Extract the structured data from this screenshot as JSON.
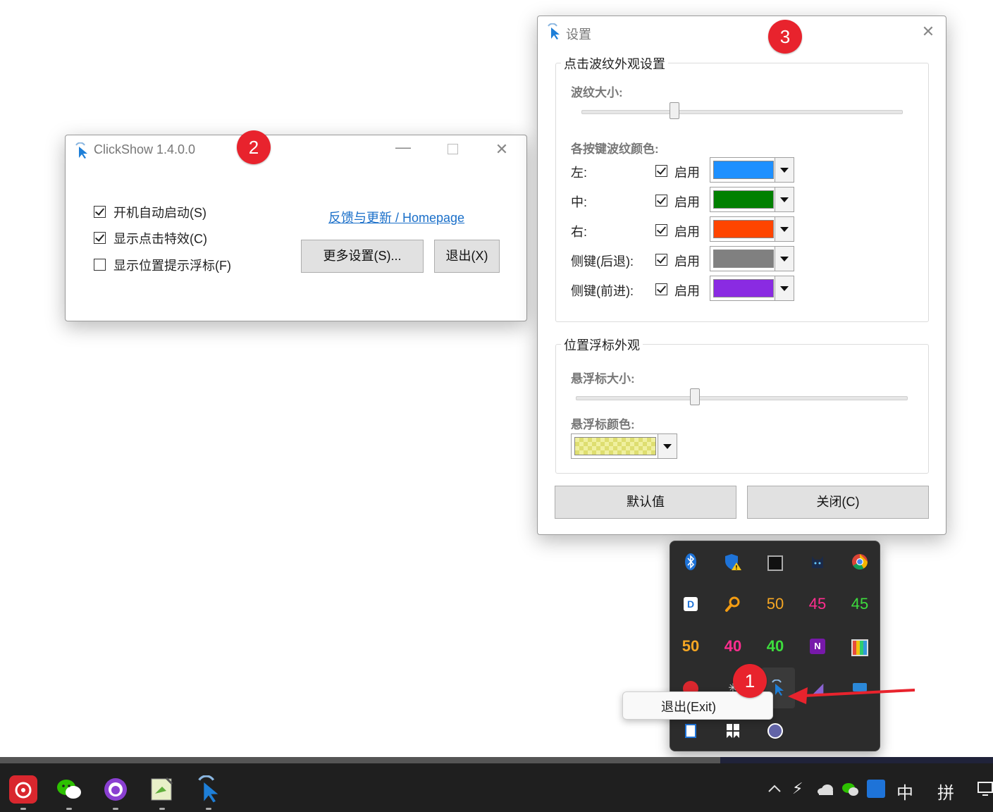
{
  "main_window": {
    "title": "ClickShow 1.4.0.0",
    "checkboxes": [
      {
        "label": "开机自动启动(S)",
        "checked": true
      },
      {
        "label": "显示点击特效(C)",
        "checked": true
      },
      {
        "label": "显示位置提示浮标(F)",
        "checked": false
      }
    ],
    "link": "反馈与更新 / Homepage",
    "more_settings_label": "更多设置(S)...",
    "exit_label": "退出(X)"
  },
  "settings_window": {
    "title": "设置",
    "ripple_group": {
      "title": "点击波纹外观设置",
      "size_label": "波纹大小:",
      "size_value": 0.29,
      "colors_label": "各按键波纹颜色:",
      "enable_label": "启用",
      "buttons": [
        {
          "label": "左:",
          "enabled": true,
          "color": "#1e90ff"
        },
        {
          "label": "中:",
          "enabled": true,
          "color": "#008000"
        },
        {
          "label": "右:",
          "enabled": true,
          "color": "#ff4500"
        },
        {
          "label": "侧键(后退):",
          "enabled": true,
          "color": "#808080"
        },
        {
          "label": "侧键(前进):",
          "enabled": true,
          "color": "#8a2be2"
        }
      ]
    },
    "marker_group": {
      "title": "位置浮标外观",
      "size_label": "悬浮标大小:",
      "size_value": 0.36,
      "color_label": "悬浮标颜色:",
      "color": "#f0f0a0"
    },
    "default_label": "默认值",
    "close_label": "关闭(C)"
  },
  "badges": [
    "1",
    "2",
    "3"
  ],
  "tray": {
    "row2_numbers": [
      "50",
      "45",
      "45"
    ],
    "row3_numbers": [
      "50",
      "40",
      "40"
    ],
    "colors": {
      "orange": "#f5a623",
      "pink": "#ff2d8f",
      "green": "#3ddc3d"
    }
  },
  "context_menu": {
    "item": "退出(Exit)"
  },
  "taskbar": {
    "ime_lang": "中",
    "ime_mode": "拼",
    "icons": [
      "netease-music-icon",
      "wechat-icon",
      "github-icon",
      "notepad-icon",
      "clickshow-icon"
    ]
  }
}
